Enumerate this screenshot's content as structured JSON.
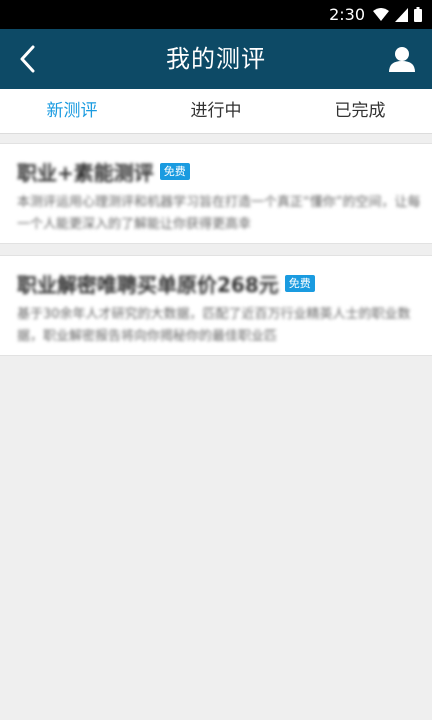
{
  "status_bar": {
    "time": "2:30"
  },
  "header": {
    "title": "我的测评"
  },
  "tabs": [
    {
      "label": "新测评"
    },
    {
      "label": "进行中"
    },
    {
      "label": "已完成"
    }
  ],
  "assessments": [
    {
      "title": "职业+素能测评",
      "badge": "免费",
      "description": "本测评运用心理测评和机器学习旨在打造一个真正“懂你”的空间，让每一个人能更深入的了解能让你获得更高幸"
    },
    {
      "title": "职业解密唯聘买单原价268元",
      "badge": "免费",
      "description": "基于30余年人才研究的大数据，匹配了近百万行业精英人士的职业数据，职业解密报告将向你揭秘你的最佳职业匹"
    }
  ]
}
